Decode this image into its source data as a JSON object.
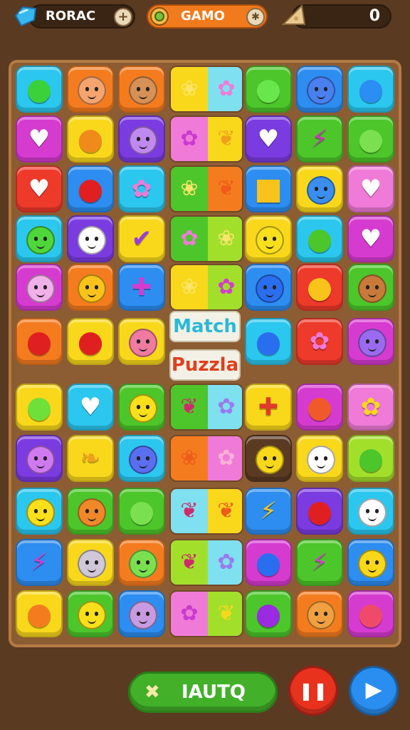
{
  "hud": {
    "currency1": {
      "label": "RORAC",
      "icon": "gem-icon",
      "add": "+"
    },
    "currency2": {
      "label": "GAMO",
      "icon": "coin-icon",
      "add": "✱"
    },
    "score": {
      "value": "0",
      "icon": "cheese-icon"
    }
  },
  "board": {
    "banner_line1": "Match",
    "banner_line2": "Puzzla",
    "colors": {
      "cyan": "#2bc7ee",
      "orange": "#f47c1f",
      "green": "#4cc62a",
      "blue": "#2d8df0",
      "magenta": "#d63bd0",
      "yellow": "#f9d81b",
      "purple": "#7a3be0",
      "red": "#ee3a2a",
      "pink": "#f07ad8",
      "lime": "#a2df2b",
      "brown": "#5a3a22"
    },
    "tiles": [
      {
        "kind": "fruit",
        "glyph": "●",
        "bg": "cyan",
        "ink": "#3bd13b"
      },
      {
        "kind": "face",
        "bg": "orange",
        "ink": "#f5a470"
      },
      {
        "kind": "face",
        "bg": "orange",
        "ink": "#d79055"
      },
      {
        "kind": "fruit",
        "glyph": "●",
        "bg": "green",
        "ink": "#69e64b"
      },
      {
        "kind": "face",
        "bg": "blue",
        "ink": "#4a7ff0"
      },
      {
        "kind": "fruit",
        "glyph": "●",
        "bg": "cyan",
        "ink": "#2a8ef2"
      },
      {
        "kind": "glyph",
        "glyph": "♥",
        "bg": "magenta",
        "ink": "#ffffff"
      },
      {
        "kind": "fruit",
        "glyph": "●",
        "bg": "yellow",
        "ink": "#f08a1a"
      },
      {
        "kind": "face",
        "bg": "purple",
        "ink": "#c089f0"
      },
      {
        "kind": "glyph",
        "glyph": "♥",
        "bg": "purple",
        "ink": "#ffffff"
      },
      {
        "kind": "glyph",
        "glyph": "⚡",
        "bg": "green",
        "ink": "#d82fc8"
      },
      {
        "kind": "fruit",
        "glyph": "●",
        "bg": "green",
        "ink": "#7ae04f"
      },
      {
        "kind": "glyph",
        "glyph": "♥",
        "bg": "red",
        "ink": "#ffffff"
      },
      {
        "kind": "fruit",
        "glyph": "●",
        "bg": "blue",
        "ink": "#e02020"
      },
      {
        "kind": "glyph",
        "glyph": "✿",
        "bg": "cyan",
        "ink": "#f07ad8"
      },
      {
        "kind": "fruit",
        "glyph": "■",
        "bg": "blue",
        "ink": "#f9c31b"
      },
      {
        "kind": "face",
        "bg": "yellow",
        "ink": "#3a8ef0"
      },
      {
        "kind": "glyph",
        "glyph": "♥",
        "bg": "pink",
        "ink": "#ffffff"
      },
      {
        "kind": "face",
        "bg": "cyan",
        "ink": "#4fd63b"
      },
      {
        "kind": "face",
        "bg": "purple",
        "ink": "#ffffff"
      },
      {
        "kind": "glyph",
        "glyph": "✔",
        "bg": "yellow",
        "ink": "#9a3be0"
      },
      {
        "kind": "face",
        "bg": "yellow",
        "ink": "#f9e01b"
      },
      {
        "kind": "fruit",
        "glyph": "●",
        "bg": "cyan",
        "ink": "#4cc62a"
      },
      {
        "kind": "glyph",
        "glyph": "♥",
        "bg": "magenta",
        "ink": "#ffffff"
      },
      {
        "kind": "face",
        "bg": "magenta",
        "ink": "#f0b0e8"
      },
      {
        "kind": "face",
        "bg": "orange",
        "ink": "#f9c31b"
      },
      {
        "kind": "glyph",
        "glyph": "✚",
        "bg": "blue",
        "ink": "#d63bd0"
      },
      {
        "kind": "face",
        "bg": "blue",
        "ink": "#2a6ef0"
      },
      {
        "kind": "fruit",
        "glyph": "●",
        "bg": "red",
        "ink": "#f9c31b"
      },
      {
        "kind": "face",
        "bg": "green",
        "ink": "#c87a3a"
      },
      {
        "kind": "fruit",
        "glyph": "●",
        "bg": "orange",
        "ink": "#e02020"
      },
      {
        "kind": "fruit",
        "glyph": "●",
        "bg": "yellow",
        "ink": "#e02020"
      },
      {
        "kind": "face",
        "bg": "yellow",
        "ink": "#f07aa0"
      },
      {
        "kind": "fruit",
        "glyph": "●",
        "bg": "cyan",
        "ink": "#2a6ef0"
      },
      {
        "kind": "glyph",
        "glyph": "✿",
        "bg": "red",
        "ink": "#f07ad8"
      },
      {
        "kind": "face",
        "bg": "magenta",
        "ink": "#9a6bf0"
      },
      {
        "kind": "fruit",
        "glyph": "●",
        "bg": "yellow",
        "ink": "#6fe03a"
      },
      {
        "kind": "glyph",
        "glyph": "♥",
        "bg": "cyan",
        "ink": "#ffffff"
      },
      {
        "kind": "face",
        "bg": "green",
        "ink": "#f9e01b"
      },
      {
        "kind": "glyph",
        "glyph": "✚",
        "bg": "yellow",
        "ink": "#e03a2a"
      },
      {
        "kind": "fruit",
        "glyph": "●",
        "bg": "magenta",
        "ink": "#f05a2a"
      },
      {
        "kind": "glyph",
        "glyph": "✿",
        "bg": "pink",
        "ink": "#f9d81b"
      },
      {
        "kind": "face",
        "bg": "purple",
        "ink": "#d07af0"
      },
      {
        "kind": "glyph",
        "glyph": "❧",
        "bg": "yellow",
        "ink": "#f0a01b"
      },
      {
        "kind": "face",
        "bg": "cyan",
        "ink": "#5a6ef0"
      },
      {
        "kind": "face",
        "bg": "brown",
        "ink": "#f9d81b"
      },
      {
        "kind": "face",
        "bg": "yellow",
        "ink": "#ffffff"
      },
      {
        "kind": "fruit",
        "glyph": "●",
        "bg": "lime",
        "ink": "#4cc62a"
      },
      {
        "kind": "face",
        "bg": "cyan",
        "ink": "#f9e01b"
      },
      {
        "kind": "face",
        "bg": "green",
        "ink": "#f0882a"
      },
      {
        "kind": "fruit",
        "glyph": "●",
        "bg": "green",
        "ink": "#7ae04f"
      },
      {
        "kind": "glyph",
        "glyph": "⚡",
        "bg": "blue",
        "ink": "#f9c31b"
      },
      {
        "kind": "fruit",
        "glyph": "●",
        "bg": "purple",
        "ink": "#e02020"
      },
      {
        "kind": "face",
        "bg": "cyan",
        "ink": "#ffffff"
      },
      {
        "kind": "glyph",
        "glyph": "⚡",
        "bg": "blue",
        "ink": "#d63bd0"
      },
      {
        "kind": "face",
        "bg": "yellow",
        "ink": "#d0c8d8"
      },
      {
        "kind": "face",
        "bg": "orange",
        "ink": "#7ae04f"
      },
      {
        "kind": "fruit",
        "glyph": "●",
        "bg": "magenta",
        "ink": "#2a6ef0"
      },
      {
        "kind": "glyph",
        "glyph": "⚡",
        "bg": "green",
        "ink": "#d63bd0"
      },
      {
        "kind": "face",
        "bg": "blue",
        "ink": "#f9d81b"
      },
      {
        "kind": "fruit",
        "glyph": "●",
        "bg": "yellow",
        "ink": "#f47c1f"
      },
      {
        "kind": "face",
        "bg": "green",
        "ink": "#f9e01b"
      },
      {
        "kind": "face",
        "bg": "blue",
        "ink": "#c89ae0"
      },
      {
        "kind": "fruit",
        "glyph": "●",
        "bg": "green",
        "ink": "#9a2be0"
      },
      {
        "kind": "face",
        "bg": "orange",
        "ink": "#f0a040"
      },
      {
        "kind": "fruit",
        "glyph": "●",
        "bg": "magenta",
        "ink": "#f04a6a"
      }
    ],
    "strips": [
      {
        "left": "❀",
        "right": "✿",
        "lbg": "#f9d81b",
        "rbg": "#7fe0f0",
        "lInk": "#f9e56b",
        "rInk": "#f07ad8"
      },
      {
        "left": "✿",
        "right": "❦",
        "lbg": "#f07ad8",
        "rbg": "#f9d81b",
        "lInk": "#c93bd0",
        "rInk": "#f0a01b"
      },
      {
        "left": "❀",
        "right": "❦",
        "lbg": "#4cc62a",
        "rbg": "#f47c1f",
        "lInk": "#f9e56b",
        "rInk": "#f05a1a"
      },
      {
        "left": "✿",
        "right": "❀",
        "lbg": "#4cc62a",
        "rbg": "#a2df2b",
        "lInk": "#f07ad8",
        "rInk": "#f9e56b"
      },
      {
        "left": "❀",
        "right": "✿",
        "lbg": "#f9d81b",
        "rbg": "#a2df2b",
        "lInk": "#f9e56b",
        "rInk": "#d63bd0"
      },
      {
        "left": "❦",
        "right": "✿",
        "lbg": "#4cc62a",
        "rbg": "#7fe0f0",
        "lInk": "#d02a6a",
        "rInk": "#9a7af0"
      },
      {
        "left": "❀",
        "right": "✿",
        "lbg": "#f47c1f",
        "rbg": "#f07ad8",
        "lInk": "#f05a1a",
        "rInk": "#f9b0d8"
      },
      {
        "left": "❦",
        "right": "❦",
        "lbg": "#7fe0f0",
        "rbg": "#f9d81b",
        "lInk": "#d02a6a",
        "rInk": "#f05a1a"
      },
      {
        "left": "❦",
        "right": "✿",
        "lbg": "#a2df2b",
        "rbg": "#7fe0f0",
        "lInk": "#d02a6a",
        "rInk": "#9a7af0"
      },
      {
        "left": "✿",
        "right": "❦",
        "lbg": "#f07ad8",
        "rbg": "#a2df2b",
        "lInk": "#c93bd0",
        "rInk": "#f9d81b"
      }
    ]
  },
  "controls": {
    "main_button_label": "IAUTQ",
    "main_button_icon": "✖",
    "pause_icon": "❚❚",
    "play_icon": "▶",
    "pause_color": "#e8321e",
    "play_color": "#2a8ef0"
  }
}
